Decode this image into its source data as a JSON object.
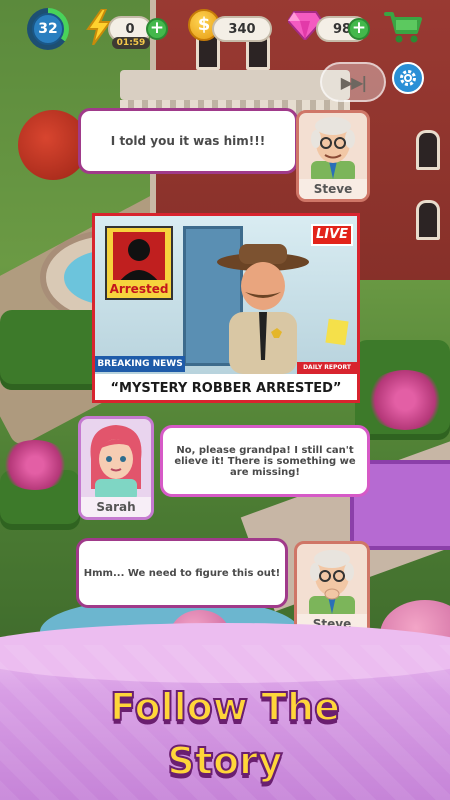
{
  "hud": {
    "level": "32",
    "energy": "0",
    "energy_timer": "01:59",
    "coins": "340",
    "gems": "98"
  },
  "dialogue": [
    {
      "speaker": "Steve",
      "text": "I told you it was him!!!"
    },
    {
      "speaker": "Sarah",
      "text": "No, please grandpa! I still can't elieve it! There is something we are missing!"
    },
    {
      "speaker": "Steve",
      "text": "Hmm... We need to figure this out!"
    }
  ],
  "news": {
    "mugshot_label": "Arrested",
    "live_label": "LIVE",
    "breaking_label": "BREAKING NEWS",
    "daily_label": "DAILY REPORT",
    "headline": "“MYSTERY ROBBER ARRESTED”"
  },
  "banner": {
    "line1": "Follow The",
    "line2": "Story"
  },
  "colors": {
    "accent": "#c684d8",
    "banner_text": "#ffd63a",
    "news_red": "#d8242e"
  }
}
